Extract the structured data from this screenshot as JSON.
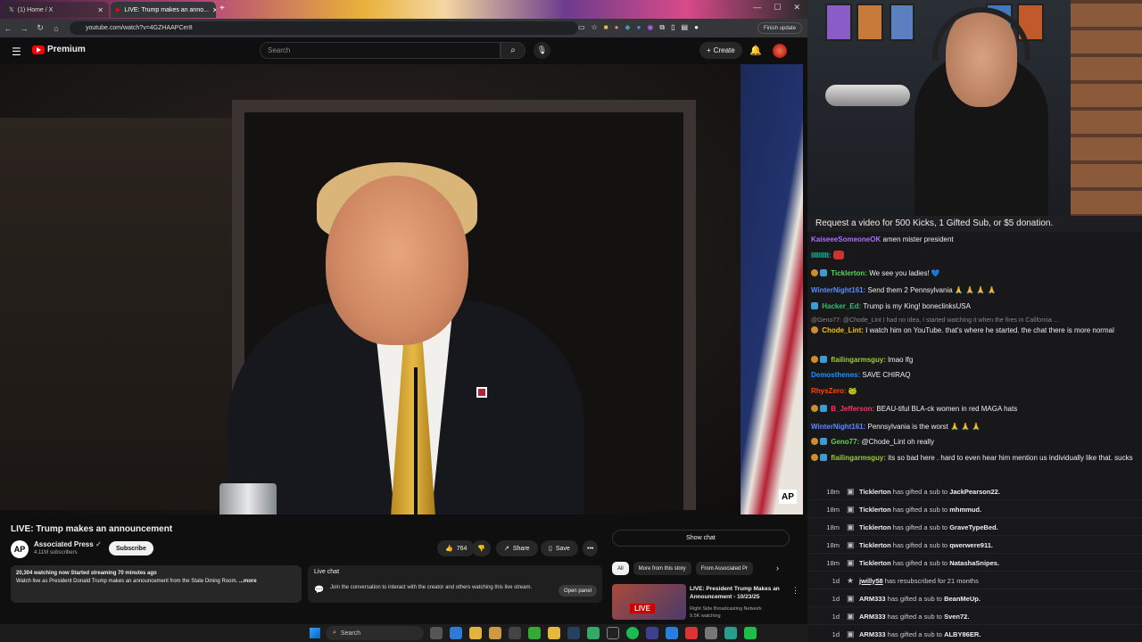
{
  "browser": {
    "tabs": [
      {
        "label": "(1) Home / X",
        "active": false
      },
      {
        "label": "LIVE: Trump makes an anno...",
        "active": true
      }
    ],
    "url": "youtube.com/watch?v=4GZHAAPCer8",
    "finish_update": "Finish update"
  },
  "youtube": {
    "brand": "Premium",
    "search_placeholder": "Search",
    "create_label": "Create"
  },
  "video": {
    "title": "LIVE: Trump makes an announcement",
    "watermark": "AP",
    "channel": {
      "avatar_text": "AP",
      "name": "Associated Press",
      "subscribers": "4.11M subscribers",
      "subscribe_label": "Subscribe"
    },
    "actions": {
      "likes": "764",
      "share": "Share",
      "save": "Save"
    },
    "description": {
      "stats": "20,304 watching now  Started streaming 70 minutes ago",
      "text": "Watch live as President Donald Trump makes an announcement from the State Dining Room.",
      "more": "...more"
    },
    "live_chat": {
      "label": "Live chat",
      "text": "Join the conversation to interact with the creator and others watching this live stream.",
      "open_panel": "Open panel"
    }
  },
  "sidebar": {
    "show_chat": "Show chat",
    "chips": [
      "All",
      "More from this story",
      "From Associated Pr"
    ],
    "rec": {
      "badge": "LIVE",
      "title": "LIVE: President Trump Makes an Announcement - 10/23/25",
      "channel": "Right Side Broadcasting Network",
      "watching": "9.5K watching"
    }
  },
  "stream_chat": {
    "banner": "Request a video for 500 Kicks, 1 Gifted Sub, or $5 donation.",
    "messages": [
      {
        "user": "KaiseeeSomeoneOK",
        "text": "amen mister president",
        "color": "#a970ff"
      },
      {
        "user": "lllllllll:",
        "text": "",
        "color": "#00c8af"
      },
      {
        "user": "Ticklerton:",
        "text": "We see you ladies! 💙",
        "color": "#5bd15b"
      },
      {
        "user": "WinterNight161:",
        "text": "Send them 2 Pennsylvania 🙏 🙏 🙏 🙏",
        "color": "#5a8cff"
      },
      {
        "user": "Hacker_Ed:",
        "text": "Trump is my King! boneclinksUSA",
        "color": "#2fbf71"
      },
      {
        "user": "Chode_Lint:",
        "text": "I watch him on YouTube. that's where he started. the chat there is more normal",
        "color": "#f0c000",
        "reply": "@Geno77: @Chode_Lint I had no idea, I started watching it when the fires in California ..."
      },
      {
        "user": "flailingarmsguy:",
        "text": "lmao lfg",
        "color": "#9acd32"
      },
      {
        "user": "Demosthenes:",
        "text": "SAVE CHIRAQ",
        "color": "#1e90ff"
      },
      {
        "user": "RhysZero:",
        "text": "🐸",
        "color": "#ff4500"
      },
      {
        "user": "B_Jefferson:",
        "text": "BEAU-tiful BLA-ck women in red MAGA hats",
        "color": "#ff3366"
      },
      {
        "user": "WinterNight161:",
        "text": "Pennsylvania is the worst 🙏 🙏 🙏",
        "color": "#5a8cff"
      },
      {
        "user": "Geno77:",
        "text": "@Chode_Lint oh really",
        "color": "#5bd15b"
      },
      {
        "user": "flailingarmsguy:",
        "text": "its so bad here . hard to even hear him mention us individually like that. sucks",
        "color": "#9acd32"
      }
    ],
    "events": [
      {
        "time": "18m",
        "text_a": "Ticklerton",
        "text_b": " has gifted a sub to ",
        "text_c": "JackPearson22."
      },
      {
        "time": "18m",
        "text_a": "Ticklerton",
        "text_b": " has gifted a sub to ",
        "text_c": "mhmmud."
      },
      {
        "time": "18m",
        "text_a": "Ticklerton",
        "text_b": " has gifted a sub to ",
        "text_c": "GraveTypeBed."
      },
      {
        "time": "18m",
        "text_a": "Ticklerton",
        "text_b": " has gifted a sub to ",
        "text_c": "qwerwere911."
      },
      {
        "time": "18m",
        "text_a": "Ticklerton",
        "text_b": " has gifted a sub to ",
        "text_c": "NatashaSnipes."
      },
      {
        "time": "1d",
        "text_a": "jwilly58",
        "text_b": " has resubscribed for 21 months",
        "text_c": ""
      },
      {
        "time": "1d",
        "text_a": "ARM333",
        "text_b": " has gifted a sub to ",
        "text_c": "BeanMeUp."
      },
      {
        "time": "1d",
        "text_a": "ARM333",
        "text_b": " has gifted a sub to ",
        "text_c": "Sven72."
      },
      {
        "time": "1d",
        "text_a": "ARM333",
        "text_b": " has gifted a sub to ",
        "text_c": "ALBY86ER."
      }
    ]
  },
  "taskbar": {
    "search": "Search"
  }
}
